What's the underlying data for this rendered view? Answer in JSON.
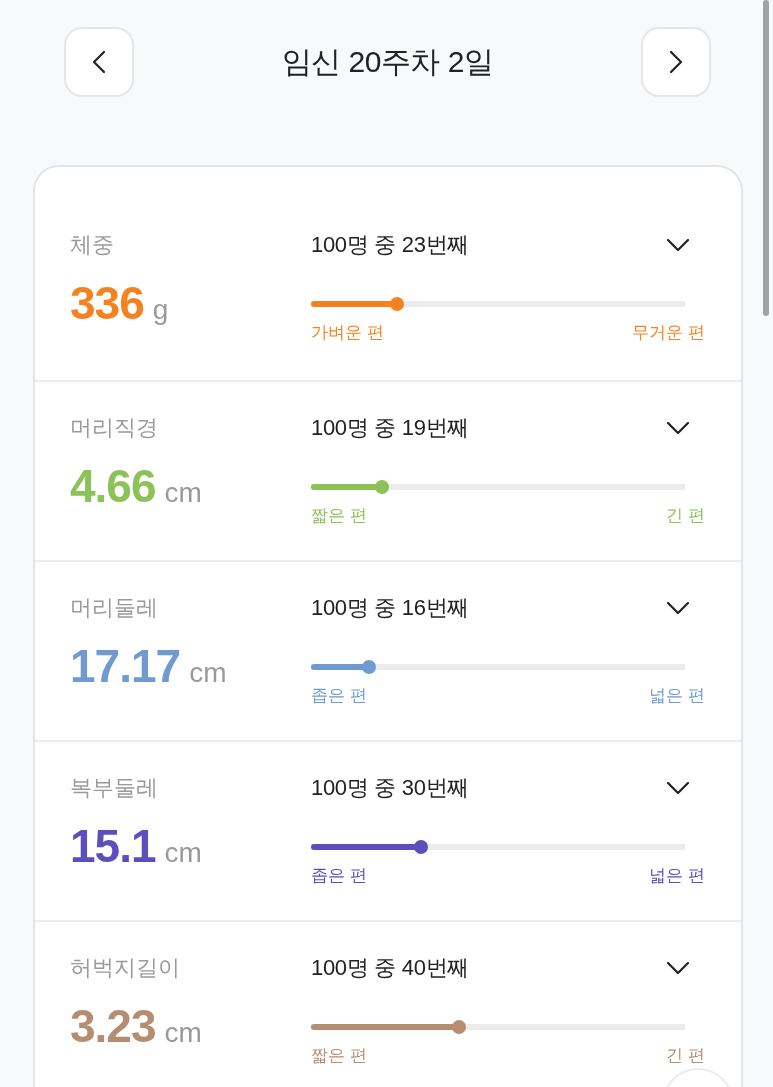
{
  "header": {
    "title": "임신 20주차 2일"
  },
  "measurements": [
    {
      "label": "체중",
      "value": "336",
      "unit": "g",
      "rank": "100명 중 23번째",
      "level": 0.23,
      "low_label": "가벼운 편",
      "high_label": "무거운 편",
      "color": "#f5821f",
      "expanded": false
    },
    {
      "label": "머리직경",
      "value": "4.66",
      "unit": "cm",
      "rank": "100명 중 19번째",
      "level": 0.19,
      "low_label": "짧은 편",
      "high_label": "긴 편",
      "color": "#8cc257",
      "expanded": false
    },
    {
      "label": "머리둘레",
      "value": "17.17",
      "unit": "cm",
      "rank": "100명 중 16번째",
      "level": 0.155,
      "low_label": "좁은 편",
      "high_label": "넓은 편",
      "color": "#6f9bd1",
      "expanded": false
    },
    {
      "label": "복부둘레",
      "value": "15.1",
      "unit": "cm",
      "rank": "100명 중 30번째",
      "level": 0.295,
      "low_label": "좁은 편",
      "high_label": "넓은 편",
      "color": "#5b4fbe",
      "expanded": false
    },
    {
      "label": "허벅지길이",
      "value": "3.23",
      "unit": "cm",
      "rank": "100명 중 40번째",
      "level": 0.395,
      "low_label": "짧은 편",
      "high_label": "긴 편",
      "color": "#b58e72",
      "expanded": false
    }
  ]
}
